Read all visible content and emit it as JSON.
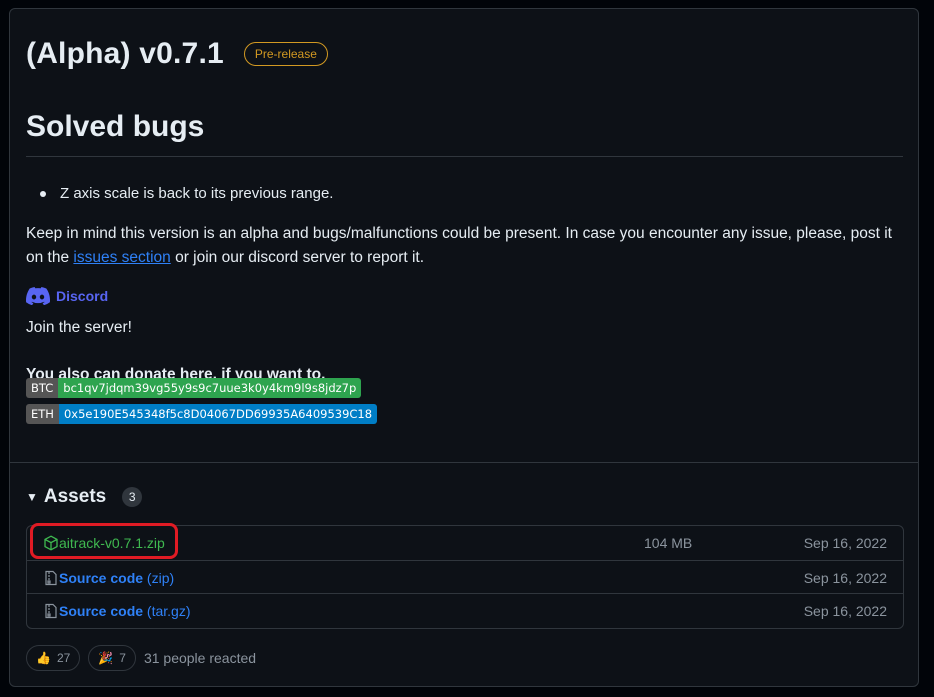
{
  "release": {
    "title": "(Alpha) v0.7.1",
    "badge": "Pre-release"
  },
  "body": {
    "heading": "Solved bugs",
    "bullets": [
      "Z axis scale is back to its previous range."
    ],
    "para_before": "Keep in mind this version is an alpha and bugs/malfunctions could be present. In case you encounter any issue, please, post it on the ",
    "para_link": "issues section",
    "para_after": " or join our discord server to report it.",
    "discord_label": "Discord",
    "join": "Join the server!",
    "donate": "You also can donate here, if you want to.",
    "btc_key": "BTC",
    "btc_value": "bc1qv7jdqm39vg55y9s9c7uue3k0y4km9l9s8jdz7p",
    "eth_key": "ETH",
    "eth_value": "0x5e190E545348f5c8D04067DD69935A6409539C18"
  },
  "assets": {
    "title": "Assets",
    "count": "3",
    "items": [
      {
        "name": "aitrack-v0.7.1.zip",
        "sub": "",
        "size": "104 MB",
        "date": "Sep 16, 2022"
      },
      {
        "name": "Source code",
        "sub": "(zip)",
        "size": "",
        "date": "Sep 16, 2022"
      },
      {
        "name": "Source code",
        "sub": "(tar.gz)",
        "size": "",
        "date": "Sep 16, 2022"
      }
    ]
  },
  "reactions": {
    "thumbs_count": "27",
    "party_count": "7",
    "summary": "31 people reacted"
  },
  "colors": {
    "accent_link": "#2f81f7",
    "prerelease": "#d29922",
    "zip_green": "#3fb950",
    "highlight_red": "#e01b24"
  }
}
